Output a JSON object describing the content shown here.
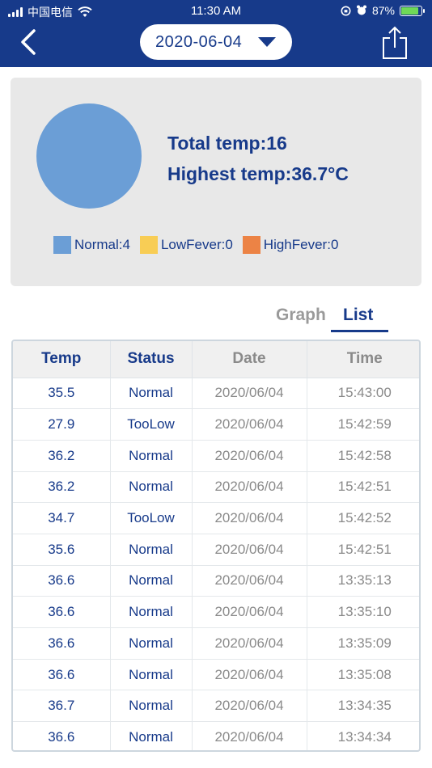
{
  "status_bar": {
    "carrier": "中国电信",
    "time": "11:30 AM",
    "battery": "87%",
    "battery_level": 0.87
  },
  "header": {
    "back_icon": "chevron-left-icon",
    "selected_date": "2020-06-04",
    "share_icon": "share-icon"
  },
  "summary": {
    "total_label": "Total temp:16",
    "highest_label": "Highest temp:36.7°C",
    "legend": [
      {
        "label": "Normal:4",
        "color": "#6b9ed6"
      },
      {
        "label": "LowFever:0",
        "color": "#f8cd55"
      },
      {
        "label": "HighFever:0",
        "color": "#ec8345"
      }
    ]
  },
  "chart_data": {
    "type": "pie",
    "categories": [
      "Normal",
      "LowFever",
      "HighFever"
    ],
    "values": [
      4,
      0,
      0
    ],
    "colors": [
      "#6b9ed6",
      "#f8cd55",
      "#ec8345"
    ]
  },
  "tabs": {
    "graph": "Graph",
    "list": "List",
    "active": "list"
  },
  "table": {
    "headers": [
      "Temp",
      "Status",
      "Date",
      "Time"
    ],
    "rows": [
      [
        "35.5",
        "Normal",
        "2020/06/04",
        "15:43:00"
      ],
      [
        "27.9",
        "TooLow",
        "2020/06/04",
        "15:42:59"
      ],
      [
        "36.2",
        "Normal",
        "2020/06/04",
        "15:42:58"
      ],
      [
        "36.2",
        "Normal",
        "2020/06/04",
        "15:42:51"
      ],
      [
        "34.7",
        "TooLow",
        "2020/06/04",
        "15:42:52"
      ],
      [
        "35.6",
        "Normal",
        "2020/06/04",
        "15:42:51"
      ],
      [
        "36.6",
        "Normal",
        "2020/06/04",
        "13:35:13"
      ],
      [
        "36.6",
        "Normal",
        "2020/06/04",
        "13:35:10"
      ],
      [
        "36.6",
        "Normal",
        "2020/06/04",
        "13:35:09"
      ],
      [
        "36.6",
        "Normal",
        "2020/06/04",
        "13:35:08"
      ],
      [
        "36.7",
        "Normal",
        "2020/06/04",
        "13:34:35"
      ],
      [
        "36.6",
        "Normal",
        "2020/06/04",
        "13:34:34"
      ]
    ]
  }
}
